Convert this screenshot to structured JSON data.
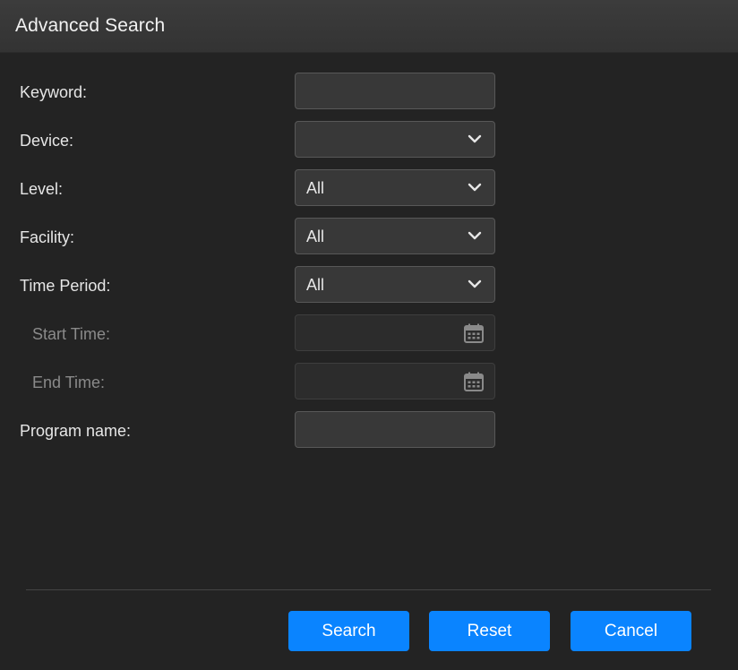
{
  "dialog": {
    "title": "Advanced Search"
  },
  "form": {
    "keyword": {
      "label": "Keyword:",
      "value": ""
    },
    "device": {
      "label": "Device:",
      "value": ""
    },
    "level": {
      "label": "Level:",
      "value": "All"
    },
    "facility": {
      "label": "Facility:",
      "value": "All"
    },
    "time_period": {
      "label": "Time Period:",
      "value": "All"
    },
    "start_time": {
      "label": "Start Time:",
      "value": "",
      "icon": "calendar-icon"
    },
    "end_time": {
      "label": "End Time:",
      "value": "",
      "icon": "calendar-icon"
    },
    "program_name": {
      "label": "Program name:",
      "value": ""
    }
  },
  "buttons": {
    "search": "Search",
    "reset": "Reset",
    "cancel": "Cancel"
  },
  "colors": {
    "background": "#232323",
    "titlebar": "#363636",
    "field": "#383838",
    "accent": "#0a84ff"
  }
}
